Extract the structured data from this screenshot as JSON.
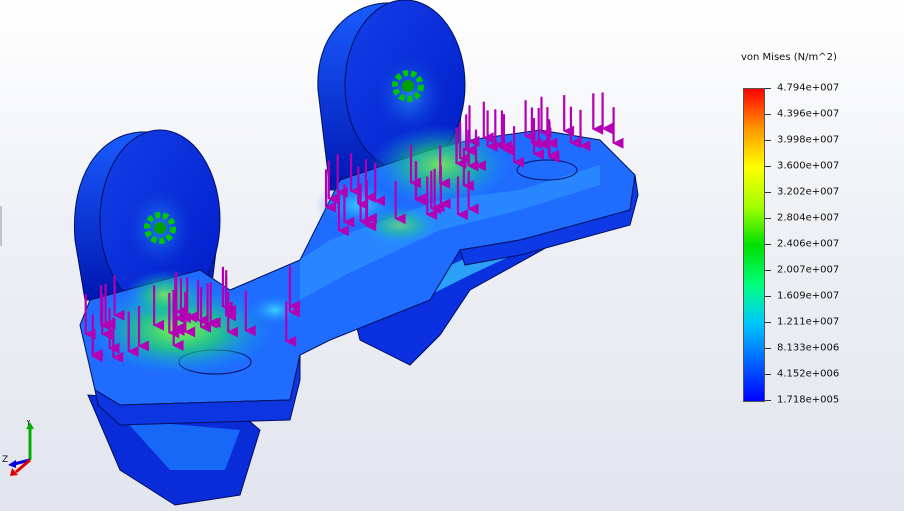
{
  "legend": {
    "title": "von Mises (N/m^2)",
    "labels": [
      "4.794e+007",
      "4.396e+007",
      "3.998e+007",
      "3.600e+007",
      "3.202e+007",
      "2.804e+007",
      "2.406e+007",
      "2.007e+007",
      "1.609e+007",
      "1.211e+007",
      "8.133e+006",
      "4.152e+006",
      "1.718e+005"
    ]
  },
  "triad": {
    "x_label": "Z",
    "y_label": "Y"
  },
  "colors": {
    "load_arrow": "#b400b4",
    "fixture": "#00c800",
    "low_stress": "#0000d8",
    "high_stress": "#ff0000"
  }
}
